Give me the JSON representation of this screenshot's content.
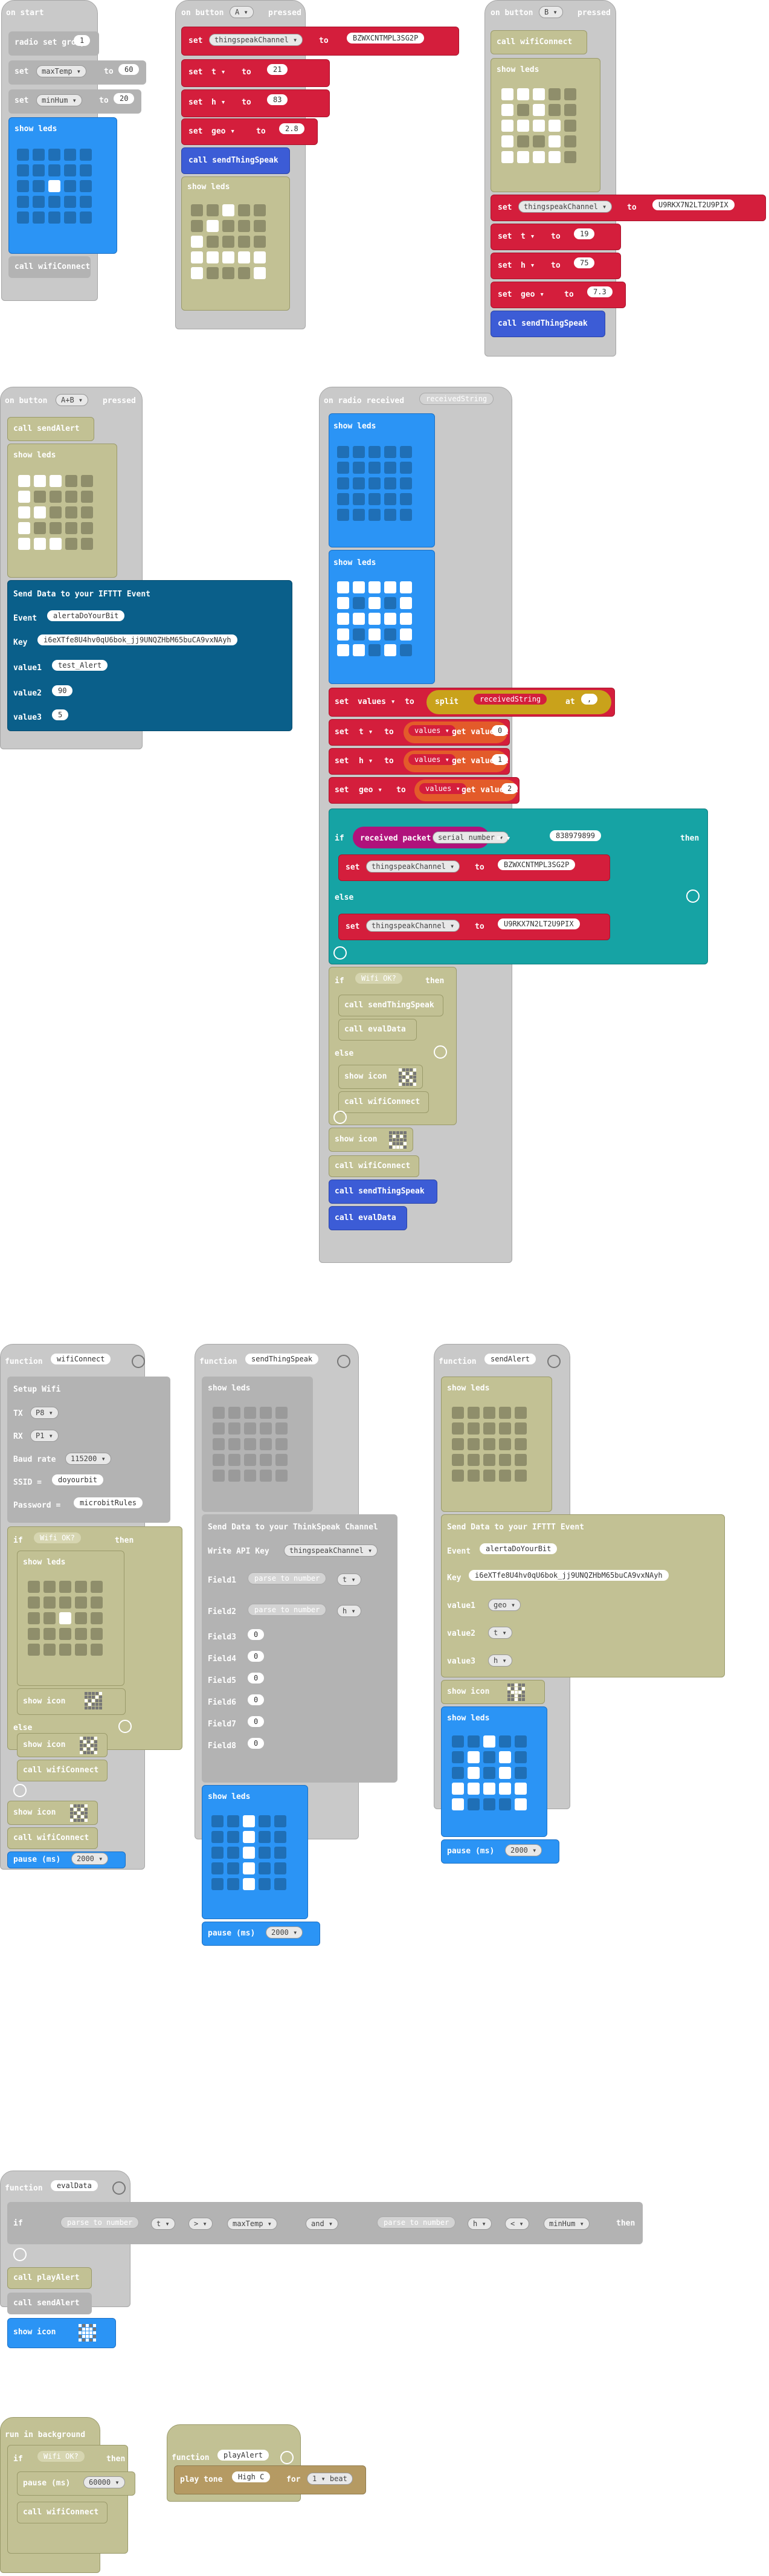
{
  "on_start": {
    "header": "on start",
    "radio_set_group": "radio set group",
    "group": "1",
    "set1": "set",
    "var1": "maxTemp ▾",
    "to1": "to",
    "val1": "60",
    "set2": "set",
    "var2": "minHum ▾",
    "to2": "to",
    "val2": "20",
    "show_leds": "show leds",
    "call": "call wifiConnect"
  },
  "btn_a": {
    "header": "on button",
    "btn": "A ▾",
    "pressed": "pressed",
    "set": "set",
    "v1": "thingspeakChannel ▾",
    "to": "to",
    "s1": "BZWXCNTMPL3SG2P",
    "v2": "t ▾",
    "n2": "21",
    "v3": "h ▾",
    "n3": "83",
    "v4": "geo ▾",
    "s4": "2.8",
    "call": "call sendThingSpeak",
    "show_leds": "show leds"
  },
  "btn_b": {
    "header": "on button",
    "btn": "B ▾",
    "pressed": "pressed",
    "call": "call wifiConnect",
    "show_leds": "show leds",
    "set": "set",
    "v1": "thingspeakChannel ▾",
    "to": "to",
    "s1": "U9RKX7N2LT2U9PIX",
    "v2": "t ▾",
    "n2": "19",
    "v3": "h ▾",
    "n3": "75",
    "v4": "geo ▾",
    "s4": "7.3",
    "call2": "call sendThingSpeak"
  },
  "btn_ab": {
    "header": "on button",
    "btn": "A+B ▾",
    "pressed": "pressed",
    "call": "call sendAlert",
    "show_leds": "show leds",
    "ifttt_title": "Send Data to your IFTTT Event",
    "event_lbl": "Event",
    "event_val": "alertaDoYourBit",
    "key_lbl": "Key",
    "key_val": "i6eXTfe8U4hv0qU6bok_jj9UNQZHbM65buCA9vxNAyh",
    "value1_lbl": "value1",
    "value1_val": "test_Alert",
    "value2_lbl": "value2",
    "value2_val": "90",
    "value3_lbl": "value3",
    "value3_val": "5"
  },
  "radio": {
    "header": "on radio received",
    "param": "receivedString",
    "show_leds": "show leds",
    "set": "set",
    "v1": "values ▾",
    "to": "to",
    "split": "split",
    "recv": "receivedString",
    "at": "at",
    "sep": ",",
    "v2": "t ▾",
    "v3": "h ▾",
    "v4": "geo ▾",
    "values_ref": "values ▾",
    "get_value": "get value at",
    "i0": "0",
    "i1": "1",
    "i2": "2",
    "if": "if",
    "packet": "received packet",
    "serial": "serial number ▾",
    "eq": "= ▾",
    "serial_val": "838979899",
    "then": "then",
    "tc": "thingspeakChannel ▾",
    "s1": "BZWXCNTMPL3SG2P",
    "else": "else",
    "s2": "U9RKX7N2LT2U9PIX",
    "wifi_ok": "Wifi OK?",
    "call_send": "call sendThingSpeak",
    "call_eval": "call evalData",
    "show_icon": "show icon",
    "call_wifi": "call wifiConnect"
  },
  "fn_wifi": {
    "header": "function",
    "name": "wifiConnect",
    "setup": "Setup Wifi",
    "tx_lbl": "TX",
    "tx": "P8 ▾",
    "rx_lbl": "RX",
    "rx": "P1 ▾",
    "baud_lbl": "Baud rate",
    "baud": "115200 ▾",
    "ssid_lbl": "SSID =",
    "ssid": "doyourbit",
    "pwd_lbl": "Password =",
    "pwd": "microbitRules",
    "if": "if",
    "wifi_ok": "Wifi OK?",
    "then": "then",
    "show_leds": "show leds",
    "show_icon": "show icon",
    "else": "else",
    "call_wifi": "call wifiConnect",
    "pause": "pause (ms)",
    "pause_val": "2000 ▾"
  },
  "fn_send": {
    "header": "function",
    "name": "sendThingSpeak",
    "show_leds": "show leds",
    "ts_title": "Send Data to your ThinkSpeak Channel",
    "api_lbl": "Write API Key",
    "api": "thingspeakChannel ▾",
    "f1": "Field1",
    "f2": "Field2",
    "parse": "parse to number",
    "t": "t ▾",
    "h": "h ▾",
    "f3": "Field3",
    "f4": "Field4",
    "f5": "Field5",
    "f6": "Field6",
    "f7": "Field7",
    "f8": "Field8",
    "zero": "0",
    "pause": "pause (ms)",
    "pause_val": "2000 ▾"
  },
  "fn_alert": {
    "header": "function",
    "name": "sendAlert",
    "show_leds": "show leds",
    "ifttt_title": "Send Data to your IFTTT Event",
    "event_lbl": "Event",
    "event_val": "alertaDoYourBit",
    "key_lbl": "Key",
    "key_val": "i6eXTfe8U4hv0qU6bok_jj9UNQZHbM65buCA9vxNAyh",
    "value1": "value1",
    "geo": "geo ▾",
    "value2": "value2",
    "t": "t ▾",
    "value3": "value3",
    "h": "h ▾",
    "show_icon": "show icon",
    "pause": "pause (ms)",
    "pause_val": "2000 ▾"
  },
  "fn_eval": {
    "header": "function",
    "name": "evalData",
    "if": "if",
    "parse": "parse to number",
    "t": "t ▾",
    "gt": "> ▾",
    "maxTemp": "maxTemp ▾",
    "and": "and ▾",
    "h": "h ▾",
    "lt": "< ▾",
    "minHum": "minHum ▾",
    "then": "then",
    "call_play": "call playAlert",
    "call_send": "call sendAlert",
    "show_icon": "show icon"
  },
  "bg": {
    "header": "run in background",
    "if": "if",
    "wifi_ok": "Wifi OK?",
    "then": "then",
    "pause": "pause (ms)",
    "pause_val": "60000 ▾",
    "call": "call wifiConnect"
  },
  "fn_play": {
    "header": "function",
    "name": "playAlert",
    "play": "play tone",
    "note": "High C",
    "for": "for",
    "beat": "1 ▾ beat"
  }
}
